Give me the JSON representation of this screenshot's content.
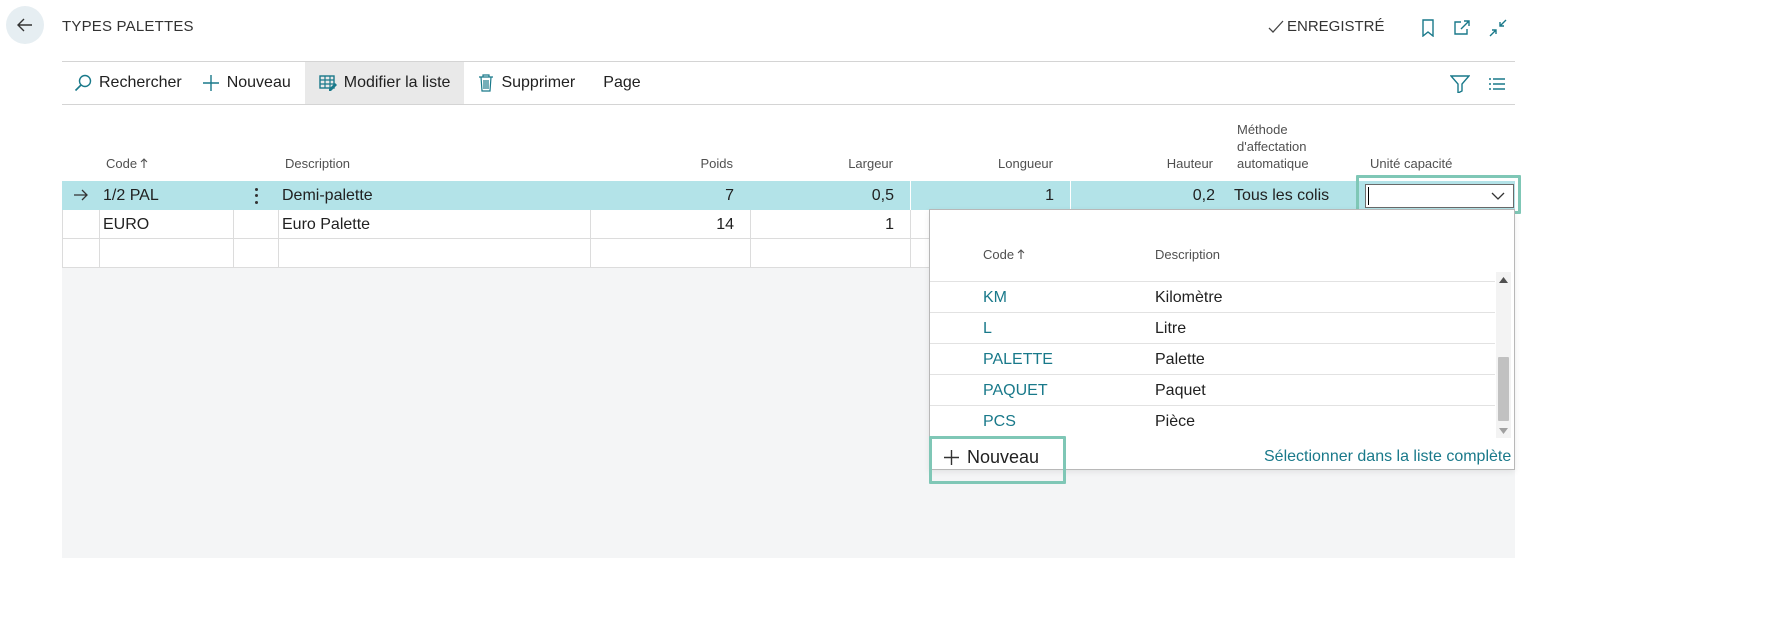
{
  "header": {
    "title": "TYPES PALETTES",
    "status": "ENREGISTRÉ"
  },
  "toolbar": {
    "search": "Rechercher",
    "new": "Nouveau",
    "edit_list": "Modifier la liste",
    "delete": "Supprimer",
    "page": "Page"
  },
  "columns": {
    "code": "Code",
    "description": "Description",
    "poids": "Poids",
    "largeur": "Largeur",
    "longueur": "Longueur",
    "hauteur": "Hauteur",
    "methode": [
      "Méthode",
      "d'affectation",
      "automatique"
    ],
    "unite": "Unité capacité"
  },
  "rows": [
    {
      "code": "1/2 PAL",
      "description": "Demi-palette",
      "poids": "7",
      "largeur": "0,5",
      "longueur": "1",
      "hauteur": "0,2",
      "methode": "Tous les colis",
      "unite": ""
    },
    {
      "code": "EURO",
      "description": "Euro Palette",
      "poids": "14",
      "largeur": "1"
    }
  ],
  "lookup": {
    "code_header": "Code",
    "description_header": "Description",
    "items": [
      {
        "code": "KM",
        "description": "Kilomètre"
      },
      {
        "code": "L",
        "description": "Litre"
      },
      {
        "code": "PALETTE",
        "description": "Palette"
      },
      {
        "code": "PAQUET",
        "description": "Paquet"
      },
      {
        "code": "PCS",
        "description": "Pièce"
      }
    ],
    "new_label": "Nouveau",
    "select_full_list": "Sélectionner dans la liste complète"
  },
  "colors": {
    "accent": "#19798a",
    "selected_row": "#b3e3e8",
    "highlight_outline": "#7fc7b6"
  },
  "icons": [
    "back-arrow-icon",
    "checkmark-icon",
    "bookmark-icon",
    "open-new-window-icon",
    "collapse-icon",
    "search-icon",
    "plus-icon",
    "edit-list-icon",
    "trash-icon",
    "filter-icon",
    "list-view-icon",
    "row-arrow-icon",
    "kebab-menu-icon",
    "chevron-down-icon",
    "sort-up-icon"
  ]
}
